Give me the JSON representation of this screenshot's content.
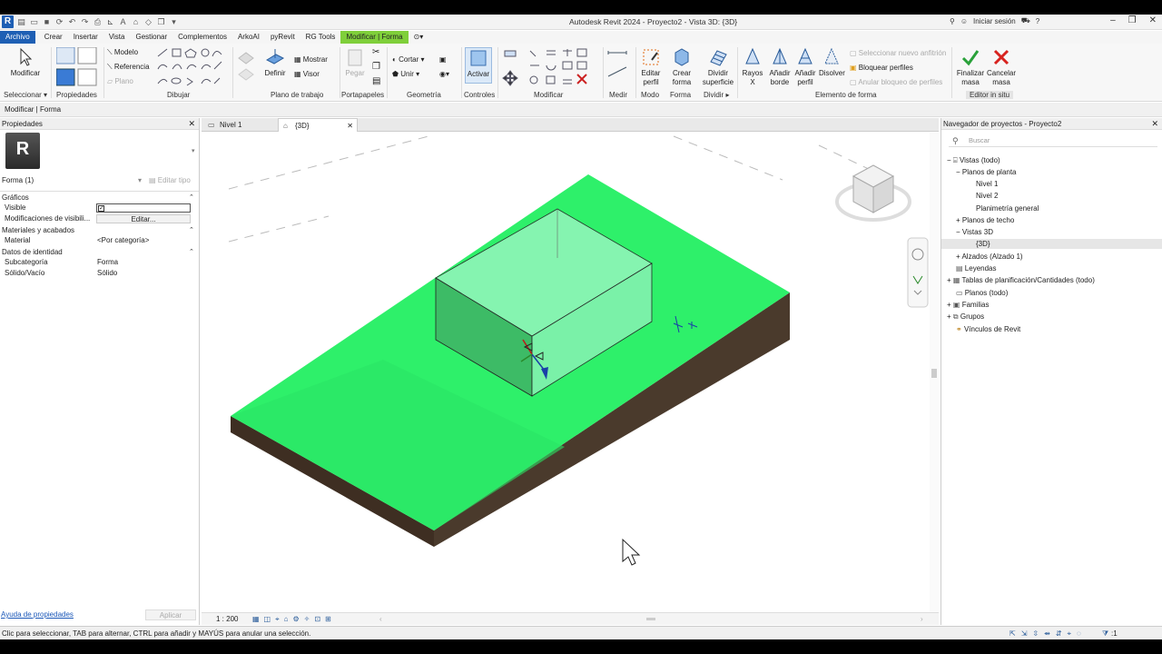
{
  "window": {
    "title": "Autodesk Revit 2024 - Proyecto2 - Vista 3D: {3D}",
    "sign_in": "Iniciar sesión"
  },
  "tabs": [
    "Archivo",
    "Crear",
    "Insertar",
    "Vista",
    "Gestionar",
    "Complementos",
    "ArkoAI",
    "pyRevit",
    "RG Tools",
    "Modificar | Forma"
  ],
  "ribbon": {
    "modificar": "Modificar",
    "modelo": "Modelo",
    "referencia": "Referencia",
    "plano": "Plano",
    "definir": "Definir",
    "mostrar": "Mostrar",
    "visor": "Visor",
    "pegar": "Pegar",
    "cortar": "Cortar",
    "unir": "Unir",
    "activar": "Activar",
    "editar_perfil": [
      "Editar",
      "perfil"
    ],
    "crear_forma": [
      "Crear",
      "forma"
    ],
    "dividir_superficie": [
      "Dividir",
      "superficie"
    ],
    "rayos_x": "Rayos X",
    "anadir_borde": [
      "Añadir",
      "borde"
    ],
    "anadir_perfil": [
      "Añadir",
      "perfil"
    ],
    "disolver": "Disolver",
    "seleccionar_anfitrion": "Seleccionar nuevo anfitrión",
    "bloquear_perfiles": "Bloquear perfiles",
    "anular_bloqueo": "Anular bloqueo de perfiles",
    "finalizar_masa": [
      "Finalizar",
      "masa"
    ],
    "cancelar_masa": [
      "Cancelar",
      "masa"
    ],
    "groups": {
      "seleccionar": "Seleccionar",
      "propiedades": "Propiedades",
      "dibujar": "Dibujar",
      "plano_trabajo": "Plano de trabajo",
      "portapapeles": "Portapapeles",
      "geometria": "Geometría",
      "controles": "Controles",
      "modificar": "Modificar",
      "medir": "Medir",
      "modo": "Modo",
      "forma": "Forma",
      "dividir": "Dividir",
      "elemento_forma": "Elemento de forma",
      "editor_in_situ": "Editor in situ"
    }
  },
  "context_bar": "Modificar | Forma",
  "properties": {
    "title": "Propiedades",
    "type_selector": "Forma (1)",
    "edit_type": "Editar tipo",
    "categories": {
      "graficos": "Gráficos",
      "materiales": "Materiales y acabados",
      "identidad": "Datos de identidad"
    },
    "rows": {
      "visible": "Visible",
      "modificaciones": "Modificaciones de visibili...",
      "editar": "Editar...",
      "material": "Material",
      "material_value": "<Por categoría>",
      "subcategoria": "Subcategoría",
      "subcategoria_value": "Forma",
      "solido_vacio": "Sólido/Vacío",
      "solido_vacio_value": "Sólido"
    },
    "help_link": "Ayuda de propiedades",
    "apply": "Aplicar"
  },
  "view_tabs": [
    "Nivel 1",
    "{3D}"
  ],
  "view_scale": "1 : 200",
  "browser": {
    "title": "Navegador de proyectos - Proyecto2",
    "search_placeholder": "Buscar",
    "items": [
      "Vistas (todo)",
      "Planos de planta",
      "Nivel 1",
      "Nivel 2",
      "Planimetría general",
      "Planos de techo",
      "Vistas 3D",
      "{3D}",
      "Alzados (Alzado 1)",
      "Leyendas",
      "Tablas de planificación/Cantidades (todo)",
      "Planos (todo)",
      "Familias",
      "Grupos",
      "Vínculos de Revit"
    ]
  },
  "status": "Clic para seleccionar, TAB para alternar, CTRL para añadir y MAYÚS para anular una selección.",
  "status_filter_count": ":1",
  "colors": {
    "accent": "#1e5fb4",
    "context_tab": "#7fcf3a",
    "terrain_top": "#2ef06a",
    "terrain_side": "#4a3a2c",
    "mass": "#7ff2ac"
  }
}
